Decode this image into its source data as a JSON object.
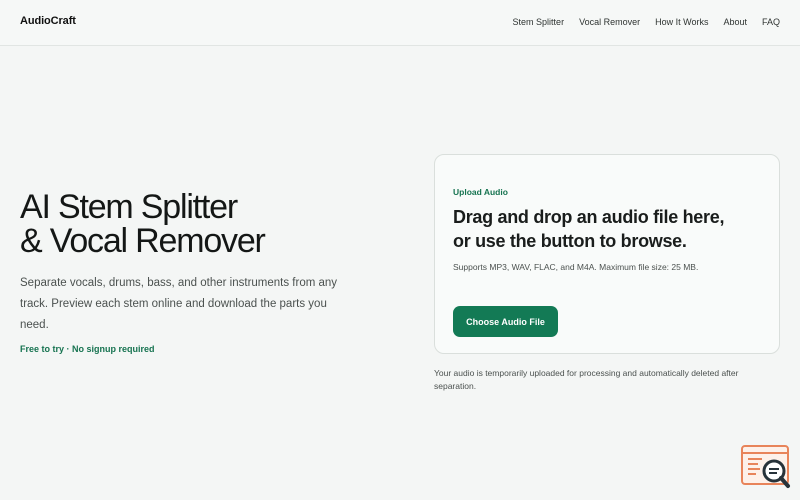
{
  "header": {
    "brand": "AudioCraft",
    "nav": [
      {
        "label": "Stem Splitter"
      },
      {
        "label": "Vocal Remover"
      },
      {
        "label": "How It Works"
      },
      {
        "label": "About"
      },
      {
        "label": "FAQ"
      }
    ]
  },
  "hero": {
    "title_line1": "AI Stem Splitter",
    "title_line2": "& Vocal Remover",
    "description": "Separate vocals, drums, bass, and other instruments from any track. Preview each stem online and download the parts you need.",
    "note": "Free to try · No signup required"
  },
  "upload": {
    "eyebrow": "Upload Audio",
    "heading_line1": "Drag and drop an audio file here,",
    "heading_line2": "or use the button to browse.",
    "formats": "Supports MP3, WAV, FLAC, and M4A. Maximum file size: 25 MB.",
    "button_label": "Choose Audio File"
  },
  "privacy_note": "Your audio is temporarily uploaded for processing and automatically deleted after separation.",
  "widget": {
    "icon": "search-chat-icon"
  },
  "colors": {
    "accent": "#137a55",
    "accent_text": "#167350",
    "background": "#f4f6f5",
    "widget_orange": "#e8845a"
  }
}
